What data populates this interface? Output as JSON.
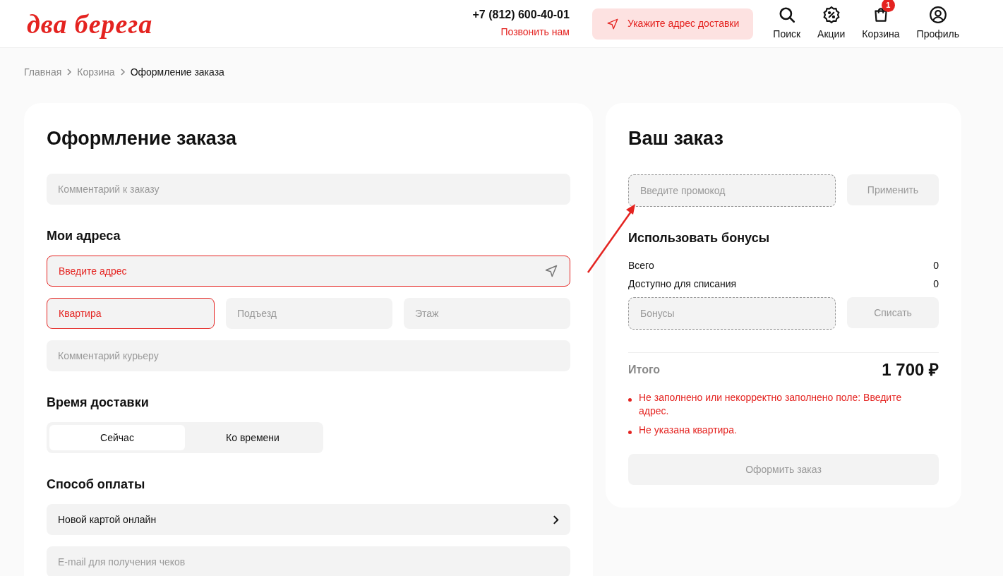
{
  "header": {
    "logo": "два берега",
    "phone": "+7 (812) 600-40-01",
    "call_link": "Позвонить нам",
    "delivery_button": "Укажите адрес доставки",
    "nav": [
      {
        "kind": "search",
        "label": "Поиск"
      },
      {
        "kind": "promo",
        "label": "Акции"
      },
      {
        "kind": "cart",
        "label": "Корзина",
        "badge": "1"
      },
      {
        "kind": "profile",
        "label": "Профиль"
      }
    ]
  },
  "breadcrumbs": [
    {
      "label": "Главная",
      "current": false
    },
    {
      "label": "Корзина",
      "current": false
    },
    {
      "label": "Оформление заказа",
      "current": true
    }
  ],
  "checkout": {
    "title": "Оформление заказа",
    "comment_placeholder": "Комментарий к заказу",
    "addresses_heading": "Мои адреса",
    "address": {
      "placeholder": "Введите адрес",
      "error": true
    },
    "details": [
      {
        "placeholder": "Квартира",
        "error": true
      },
      {
        "placeholder": "Подъезд",
        "error": false
      },
      {
        "placeholder": "Этаж",
        "error": false
      }
    ],
    "courier_comment_placeholder": "Комментарий курьеру",
    "delivery_heading": "Время доставки",
    "delivery_options": [
      {
        "label": "Сейчас",
        "selected": true
      },
      {
        "label": "Ко времени",
        "selected": false
      }
    ],
    "payment_heading": "Способ оплаты",
    "payment_method": "Новой картой онлайн",
    "email_placeholder": "E-mail для получения чеков"
  },
  "order": {
    "title": "Ваш заказ",
    "promo_placeholder": "Введите промокод",
    "apply_button": "Применить",
    "bonuses_heading": "Использовать бонусы",
    "bonus_rows": [
      {
        "label": "Всего",
        "value": "0"
      },
      {
        "label": "Доступно для списания",
        "value": "0"
      }
    ],
    "bonus_placeholder": "Бонусы",
    "write_off_button": "Списать",
    "total_label": "Итого",
    "total_value": "1 700 ₽",
    "errors": [
      "Не заполнено или некорректно заполнено поле: Введите адрес.",
      "Не указана квартира."
    ],
    "submit_button": {
      "label": "Оформить заказ",
      "disabled": true
    }
  }
}
